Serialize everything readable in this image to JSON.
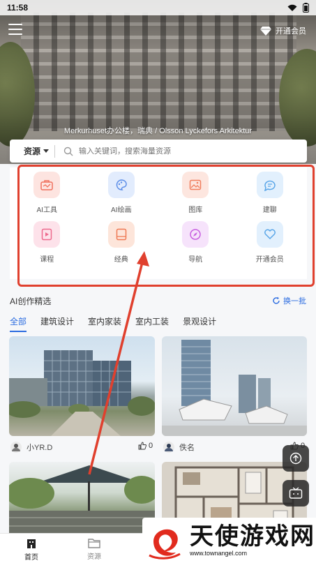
{
  "status_bar": {
    "time": "11:58"
  },
  "header": {
    "vip_label": "开通会员",
    "caption": "Merkurhuset办公楼，瑞典 / Olsson Lyckefors Arkitektur"
  },
  "search": {
    "category": "资源",
    "placeholder": "输入关键词，搜索海量资源"
  },
  "quick_links": [
    {
      "label": "AI工具",
      "icon": "toolbox-icon",
      "bg": "#fde4e0",
      "fg": "#f0705d"
    },
    {
      "label": "AI绘画",
      "icon": "palette-icon",
      "bg": "#e2ecfd",
      "fg": "#5b8de8"
    },
    {
      "label": "图库",
      "icon": "image-icon",
      "bg": "#fde6df",
      "fg": "#f07e5e"
    },
    {
      "label": "建聊",
      "icon": "chat-icon",
      "bg": "#e2f0fd",
      "fg": "#5aa6e8"
    },
    {
      "label": "课程",
      "icon": "video-icon",
      "bg": "#fde2ea",
      "fg": "#ee6a8e"
    },
    {
      "label": "经典",
      "icon": "book-icon",
      "bg": "#fde5da",
      "fg": "#ef7a55"
    },
    {
      "label": "导航",
      "icon": "compass-icon",
      "bg": "#f6e3fb",
      "fg": "#c860e0"
    },
    {
      "label": "开通会员",
      "icon": "vip-heart-icon",
      "bg": "#e2f0fd",
      "fg": "#5aa6e8"
    }
  ],
  "ai_section": {
    "title": "AI创作精选",
    "refresh": "换一批",
    "tabs": [
      "全部",
      "建筑设计",
      "室内家装",
      "室内工装",
      "景观设计"
    ],
    "cards": [
      {
        "author": "小YR.D",
        "likes": "0"
      },
      {
        "author": "佚名",
        "likes": "0"
      }
    ],
    "float_likes": "0"
  },
  "bottom_nav": [
    {
      "label": "首页",
      "icon": "home-icon"
    },
    {
      "label": "资源",
      "icon": "folder-icon"
    }
  ],
  "watermark": {
    "text": "天使游戏网",
    "sub": "www.townangel.com"
  },
  "colors": {
    "accent": "#2a6be0",
    "annotation": "#e0402e"
  }
}
